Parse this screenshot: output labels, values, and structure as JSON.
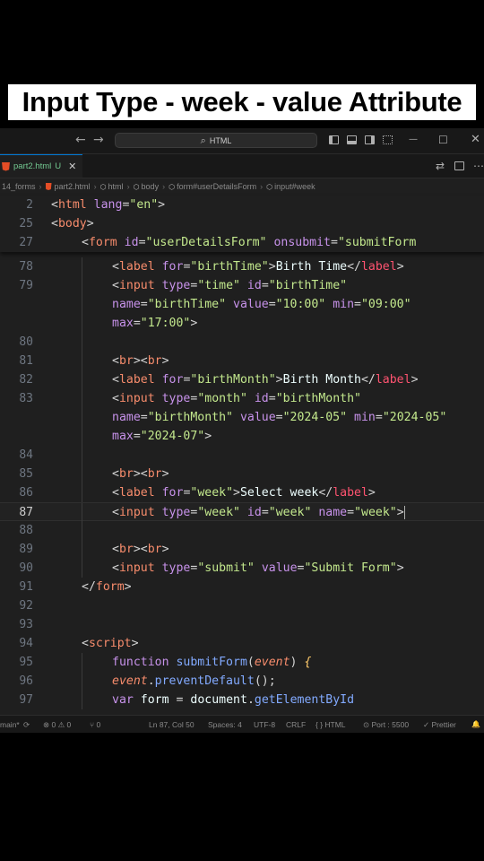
{
  "banner": {
    "title": "Input Type - week - value Attribute"
  },
  "titlebar": {
    "back_glyph": "←",
    "forward_glyph": "→",
    "command_center": "HTML",
    "search_glyph": "⌕",
    "minimize_glyph": "—",
    "maximize_glyph": "☐",
    "close_glyph": "✕"
  },
  "tab": {
    "label": "part2.html",
    "status": "U",
    "close_glyph": "✕"
  },
  "breadcrumbs": [
    "14_forms",
    "part2.html",
    "html",
    "body",
    "form#userDetailsForm",
    "input#week"
  ],
  "lines": {
    "n2": "2",
    "n25": "25",
    "n27": "27",
    "n78": "78",
    "n79": "79",
    "n80": "80",
    "n81": "81",
    "n82": "82",
    "n83": "83",
    "n84": "84",
    "n85": "85",
    "n86": "86",
    "n87": "87",
    "n88": "88",
    "n89": "89",
    "n90": "90",
    "n91": "91",
    "n92": "92",
    "n93": "93",
    "n94": "94",
    "n95": "95",
    "n96": "96",
    "n97": "97"
  },
  "code": {
    "html_tag": "html",
    "lang_attr": "lang",
    "lang_val": "\"en\"",
    "body_tag": "body",
    "form_tag": "form",
    "id_attr": "id",
    "form_id_val": "\"userDetailsForm\"",
    "onsubmit_attr": "onsubmit",
    "onsubmit_val": "\"submitForm",
    "label_tag": "label",
    "input_tag": "input",
    "br_tag": "br",
    "for_attr": "for",
    "type_attr": "type",
    "name_attr": "name",
    "value_attr": "value",
    "min_attr": "min",
    "max_attr": "max",
    "bt_for": "\"birthTime\"",
    "bt_text": "Birth Time",
    "type_time": "\"time\"",
    "bt_id": "\"birthTime\"",
    "bt_name": "\"birthTime\"",
    "bt_value": "\"10:00\"",
    "bt_min": "\"09:00\"",
    "bt_max": "\"17:00\"",
    "bm_for": "\"birthMonth\"",
    "bm_text": "Birth Month",
    "type_month": "\"month\"",
    "bm_id": "\"birthMonth\"",
    "bm_name": "\"birthMonth\"",
    "bm_value": "\"2024-05\"",
    "bm_min": "\"2024-05\"",
    "bm_max": "\"2024-07\"",
    "wk_for": "\"week\"",
    "wk_text": "Select week",
    "type_week": "\"week\"",
    "wk_id": "\"week\"",
    "wk_name": "\"week\"",
    "type_submit": "\"submit\"",
    "submit_value": "\"Submit Form\"",
    "script_tag": "script",
    "function_kw": "function",
    "fn_name": "submitForm",
    "param": "event",
    "prevent": "preventDefault",
    "var_kw": "var",
    "form_var": "form",
    "document_obj": "document",
    "get_el": "getElementById"
  },
  "statusbar": {
    "branch": "main*",
    "sync_glyph": "⟳",
    "problems": "⊗ 0 ⚠ 0",
    "ports": "⑂ 0",
    "position": "Ln 87, Col 50",
    "spaces": "Spaces: 4",
    "encoding": "UTF-8",
    "eol": "CRLF",
    "language": "{ } HTML",
    "port": "⊙ Port : 5500",
    "prettier": "✓ Prettier",
    "bell_glyph": "🔔"
  }
}
